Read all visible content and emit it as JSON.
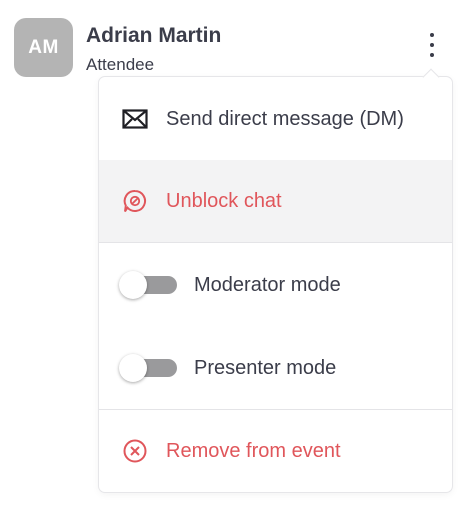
{
  "user": {
    "initials": "AM",
    "name": "Adrian Martin",
    "role": "Attendee"
  },
  "menu": {
    "items": [
      {
        "label": "Send direct message (DM)",
        "icon": "envelope-icon"
      },
      {
        "label": "Unblock chat",
        "icon": "unblock-chat-icon"
      },
      {
        "label": "Moderator mode",
        "icon": "toggle",
        "enabled": false
      },
      {
        "label": "Presenter mode",
        "icon": "toggle",
        "enabled": false
      },
      {
        "label": "Remove from event",
        "icon": "remove-circle-icon"
      }
    ]
  },
  "colors": {
    "text": "#3b3d4a",
    "danger": "#e0565b",
    "avatar_bg": "#b4b4b4",
    "highlight_bg": "#f3f3f4",
    "toggle_off": "#9a9a9c"
  }
}
